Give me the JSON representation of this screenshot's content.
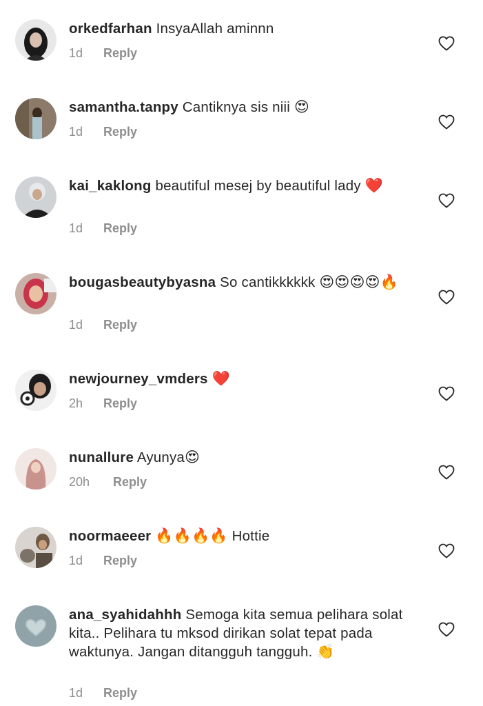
{
  "comments": [
    {
      "username": "orkedfarhan",
      "text": "InsyaAllah aminnn",
      "emoji": "",
      "time": "1d",
      "reply": "Reply"
    },
    {
      "username": "samantha.tanpy",
      "text": "Cantiknya sis niii",
      "emoji": "😍",
      "time": "1d",
      "reply": "Reply"
    },
    {
      "username": "kai_kaklong",
      "text": "beautiful mesej by beautiful lady",
      "emoji": "❤️",
      "time": "1d",
      "reply": "Reply"
    },
    {
      "username": "bougasbeautybyasna",
      "text": "So cantikkkkkk",
      "emoji": "😍😍😍😍🔥",
      "time": "1d",
      "reply": "Reply"
    },
    {
      "username": "newjourney_vmders",
      "text": "",
      "emoji": "❤️",
      "time": "2h",
      "reply": "Reply"
    },
    {
      "username": "nunallure",
      "text": "Ayunya",
      "emoji": "😍",
      "time": "20h",
      "reply": "Reply"
    },
    {
      "username": "noormaeeer",
      "text": "Hottie",
      "emoji": "🔥🔥🔥🔥",
      "time": "1d",
      "reply": "Reply"
    },
    {
      "username": "ana_syahidahhh",
      "text": "Semoga kita semua pelihara solat kita.. Pelihara tu mksod dirikan solat tepat pada waktunya. Jangan ditangguh tangguh.",
      "emoji": "👏",
      "time": "1d",
      "reply": "Reply"
    }
  ],
  "icons": {
    "like": "heart-outline-icon",
    "avatar": "user-avatar"
  },
  "colors": {
    "text": "#262626",
    "meta": "#8e8e8e",
    "heart": "#262626"
  }
}
